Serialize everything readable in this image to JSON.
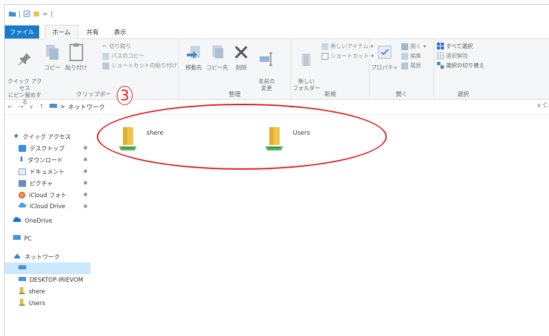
{
  "titlebar": {
    "separator": "|",
    "dropdown": "="
  },
  "tabs": [
    {
      "label": "ファイル"
    },
    {
      "label": "ホーム"
    },
    {
      "label": "共有"
    },
    {
      "label": "表示"
    }
  ],
  "ribbon": {
    "clipboard": {
      "pin_label": "クイック アクセス\nにピン留めする",
      "copy_label": "コピー",
      "paste_label": "貼り付け",
      "cut_label": "切り取り",
      "copy_path_label": "パスのコピー",
      "paste_shortcut_label": "ショートカットの貼り付け",
      "group_label": "クリップボー"
    },
    "organize": {
      "move_label": "移動先",
      "copyto_label": "コピー先",
      "delete_label": "削除",
      "rename_label": "名前の\n変更",
      "group_label": "整理"
    },
    "new": {
      "newfolder_label": "新しい\nフォルダー",
      "newitem_label": "新しいアイテム",
      "shortcut_label": "ショートカット",
      "group_label": "新規"
    },
    "open": {
      "properties_label": "プロパティ",
      "open_label": "開く",
      "edit_label": "編集",
      "history_label": "履歴",
      "group_label": "開く"
    },
    "select": {
      "select_all_label": "すべて選択",
      "select_none_label": "選択解除",
      "invert_label": "選択の切り替え",
      "group_label": "選択"
    }
  },
  "address": {
    "back": "←",
    "forward": "→",
    "recent": "∨",
    "up": "↑",
    "separator": ">",
    "path": "ネットワーク",
    "dropdown": "∨ C"
  },
  "sidebar": {
    "quick_access": "クイック アクセス",
    "items": [
      {
        "label": "デスクトップ",
        "color": "#3a8ee6"
      },
      {
        "label": "ダウンロード",
        "color": "#2f6fc9"
      },
      {
        "label": "ドキュメント",
        "color": "#8aa4c8"
      },
      {
        "label": "ピクチャ",
        "color": "#6e8fb3"
      },
      {
        "label": "iCloud フォト",
        "color": "#e0a22c"
      },
      {
        "label": "iCloud Drive",
        "color": "#4aa3e0"
      }
    ],
    "pin": "✱",
    "onedrive": "OneDrive",
    "pc": "PC",
    "network": "ネットワーク",
    "network_children": [
      {
        "label": ""
      },
      {
        "label": "DESKTOP-IRIEVOM"
      },
      {
        "label": "shere"
      },
      {
        "label": "Users"
      }
    ]
  },
  "content": {
    "items": [
      {
        "label": "shere"
      },
      {
        "label": "Users"
      }
    ]
  },
  "annotation": {
    "marker": "3",
    "color": "#e0191e"
  },
  "colors": {
    "file_tab": "#1979ca",
    "selection": "#cce8ff",
    "ribbon_bg": "#f5f6f7"
  }
}
